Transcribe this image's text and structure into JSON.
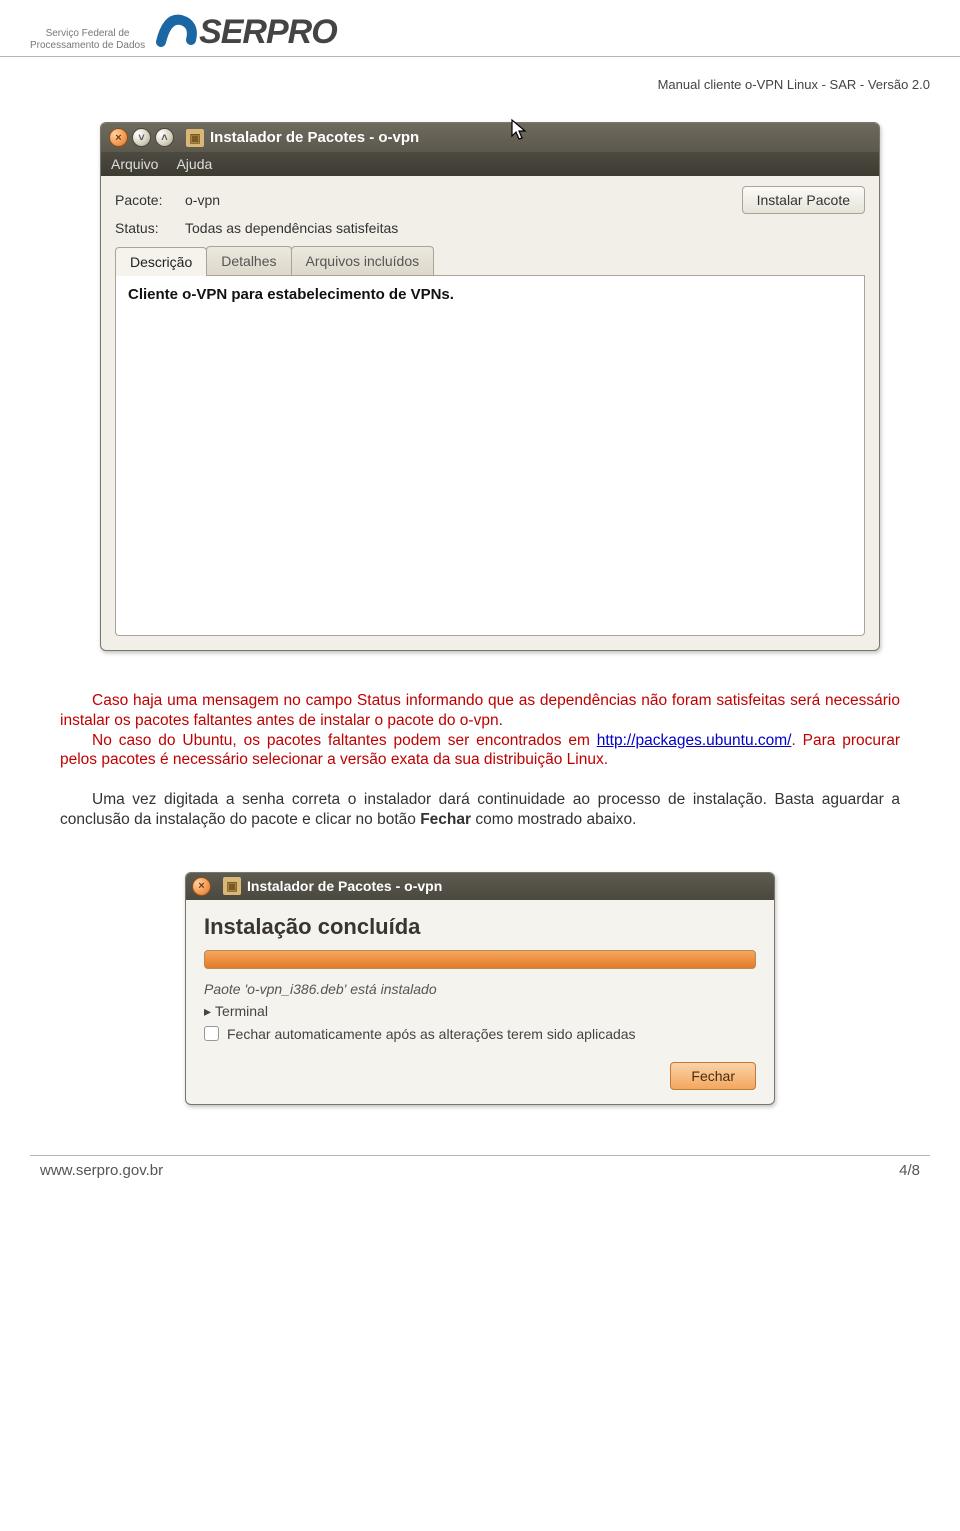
{
  "header": {
    "subtitle_line1": "Serviço Federal de",
    "subtitle_line2": "Processamento de Dados",
    "logo_text": "SERPRO",
    "doc_title": "Manual cliente o-VPN Linux - SAR - Versão 2.0"
  },
  "win1": {
    "title": "Instalador de Pacotes - o-vpn",
    "menu": {
      "arquivo": "Arquivo",
      "ajuda": "Ajuda"
    },
    "pacote_label": "Pacote:",
    "pacote_value": "o-vpn",
    "status_label": "Status:",
    "status_value": "Todas as dependências satisfeitas",
    "install_button": "Instalar Pacote",
    "tabs": {
      "descricao": "Descrição",
      "detalhes": "Detalhes",
      "arquivos": "Arquivos incluídos"
    },
    "desc_content": "Cliente o-VPN para estabelecimento de VPNs."
  },
  "paragraphs": {
    "p1a": "Caso haja uma mensagem no campo Status informando que as dependências não foram satisfeitas será necessário instalar os pacotes faltantes antes de instalar o pacote do o-vpn.",
    "p1b_1": "No caso do Ubuntu, os pacotes faltantes podem ser encontrados em ",
    "p1b_link": "http://packages.ubuntu.com/",
    "p1b_2": ". Para procurar pelos pacotes é necessário selecionar a versão exata da sua distribuição Linux.",
    "p2_1": "Uma vez digitada a senha correta o instalador dará continuidade ao processo de instalação. Basta aguardar a conclusão da instalação do pacote e clicar no botão ",
    "p2_bold": "Fechar",
    "p2_2": " como mostrado abaixo."
  },
  "win2": {
    "title": "Instalador de Pacotes - o-vpn",
    "heading": "Instalação concluída",
    "sub": "Paote 'o-vpn_i386.deb' está instalado",
    "terminal": "Terminal",
    "checkbox_label": "Fechar automaticamente após as alterações terem sido aplicadas",
    "fechar_button": "Fechar"
  },
  "footer": {
    "url": "www.serpro.gov.br",
    "page": "4/8"
  }
}
